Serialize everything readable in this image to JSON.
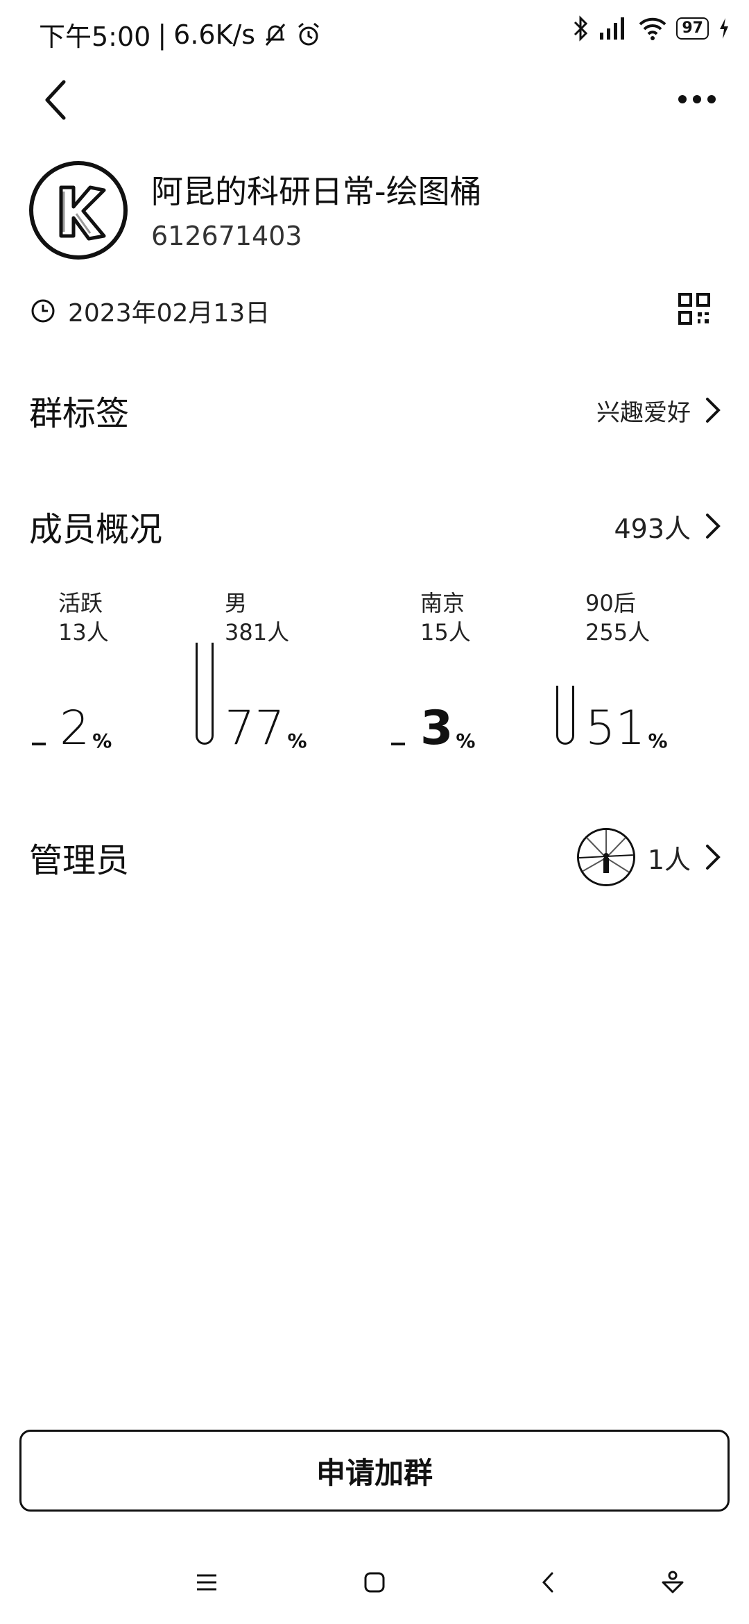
{
  "status_bar": {
    "time": "下午5:00",
    "net_speed": "6.6K/s",
    "battery": "97"
  },
  "group": {
    "name": "阿昆的科研日常-绘图桶",
    "id": "612671403",
    "created_date": "2023年02月13日"
  },
  "tags": {
    "label": "群标签",
    "value": "兴趣爱好"
  },
  "members": {
    "label": "成员概况",
    "count": "493人",
    "stats": [
      {
        "label": "活跃",
        "count": "13人",
        "percent": "2",
        "fill": 0.02
      },
      {
        "label": "男",
        "count": "381人",
        "percent": "77",
        "fill": 0.77
      },
      {
        "label": "南京",
        "count": "15人",
        "percent": "3",
        "fill": 0.03
      },
      {
        "label": "90后",
        "count": "255人",
        "percent": "51",
        "fill": 0.51
      }
    ],
    "percent_sign": "%"
  },
  "admins": {
    "label": "管理员",
    "count": "1人"
  },
  "join_button": "申请加群",
  "icons": {
    "back": "back-arrow-icon",
    "more": "more-dots-icon",
    "clock": "clock-icon",
    "qr": "qr-code-icon",
    "chevron": "chevron-right-icon"
  },
  "colors": {
    "text": "#111111",
    "background": "#ffffff"
  }
}
